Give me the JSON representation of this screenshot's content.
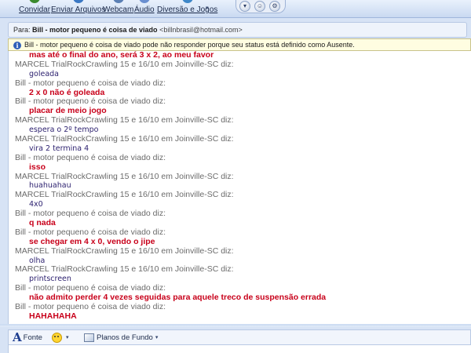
{
  "toolbar": {
    "items": [
      {
        "label": "Convidar",
        "icon": "invite-icon",
        "color": "#3b8a2e"
      },
      {
        "label": "Enviar Arquivos",
        "icon": "send-files-icon",
        "color": "#3a78c4"
      },
      {
        "label": "Webcam",
        "icon": "webcam-icon",
        "color": "#5a7fb4"
      },
      {
        "label": "Áudio",
        "icon": "audio-icon",
        "color": "#6a8fd0"
      },
      {
        "label": "Diversão e Jogos",
        "icon": "games-icon",
        "color": "#3e87c8"
      }
    ],
    "round_buttons": [
      "▾",
      "☺",
      "⚙"
    ]
  },
  "to_bar": {
    "prefix": "Para:",
    "name": "Bill - motor pequeno é coisa de viado",
    "email": "<billnbrasil@hotmail.com>"
  },
  "info_bar": {
    "icon": "i",
    "text": "Bill - motor pequeno é coisa de viado pode não responder porque seu status está definido como Ausente."
  },
  "conversation": [
    {
      "type": "msg",
      "style": "red",
      "text": "mas até o final do ano, será 3 x 2, ao meu favor"
    },
    {
      "type": "header",
      "text": "MARCEL TrialRockCrawling 15 e 16/10 em Joinville-SC diz:"
    },
    {
      "type": "msg",
      "style": "blue",
      "text": "goleada"
    },
    {
      "type": "header",
      "text": "Bill - motor pequeno é coisa de viado diz:"
    },
    {
      "type": "msg",
      "style": "red",
      "text": "2 x 0 não é goleada"
    },
    {
      "type": "header",
      "text": "Bill - motor pequeno é coisa de viado diz:"
    },
    {
      "type": "msg",
      "style": "red",
      "text": "placar de meio jogo"
    },
    {
      "type": "header",
      "text": "MARCEL TrialRockCrawling 15 e 16/10 em Joinville-SC diz:"
    },
    {
      "type": "msg",
      "style": "blue",
      "text": "espera o 2º tempo"
    },
    {
      "type": "header",
      "text": "MARCEL TrialRockCrawling 15 e 16/10 em Joinville-SC diz:"
    },
    {
      "type": "msg",
      "style": "blue",
      "text": "vira 2 termina 4"
    },
    {
      "type": "header",
      "text": "Bill - motor pequeno é coisa de viado diz:"
    },
    {
      "type": "msg",
      "style": "red",
      "text": "isso"
    },
    {
      "type": "header",
      "text": "MARCEL TrialRockCrawling 15 e 16/10 em Joinville-SC diz:"
    },
    {
      "type": "msg",
      "style": "blue",
      "text": "huahuahau"
    },
    {
      "type": "header",
      "text": "MARCEL TrialRockCrawling 15 e 16/10 em Joinville-SC diz:"
    },
    {
      "type": "msg",
      "style": "blue",
      "text": "4x0"
    },
    {
      "type": "header",
      "text": "Bill - motor pequeno é coisa de viado diz:"
    },
    {
      "type": "msg",
      "style": "red",
      "text": "q nada"
    },
    {
      "type": "header",
      "text": "Bill - motor pequeno é coisa de viado diz:"
    },
    {
      "type": "msg",
      "style": "red",
      "text": "se chegar em 4 x 0, vendo o jipe"
    },
    {
      "type": "header",
      "text": "MARCEL TrialRockCrawling 15 e 16/10 em Joinville-SC diz:"
    },
    {
      "type": "msg",
      "style": "blue",
      "text": "olha"
    },
    {
      "type": "header",
      "text": "MARCEL TrialRockCrawling 15 e 16/10 em Joinville-SC diz:"
    },
    {
      "type": "msg",
      "style": "blue",
      "text": "printscreen"
    },
    {
      "type": "header",
      "text": "Bill - motor pequeno é coisa de viado diz:"
    },
    {
      "type": "msg",
      "style": "red",
      "text": "não admito perder 4 vezes seguidas para aquele treco de suspensão errada"
    },
    {
      "type": "header",
      "text": "Bill - motor pequeno é coisa de viado diz:"
    },
    {
      "type": "msg",
      "style": "red",
      "text": "HAHAHAHA"
    }
  ],
  "format_bar": {
    "font_glyph": "A",
    "font_label": "Fonte",
    "emoticon_caret": "▾",
    "background_label": "Planos de Fundo",
    "background_caret": "▾"
  },
  "colors": {
    "accent": "#c8001a",
    "other_text": "#2b1f6e",
    "header_text": "#6b6b6b"
  }
}
